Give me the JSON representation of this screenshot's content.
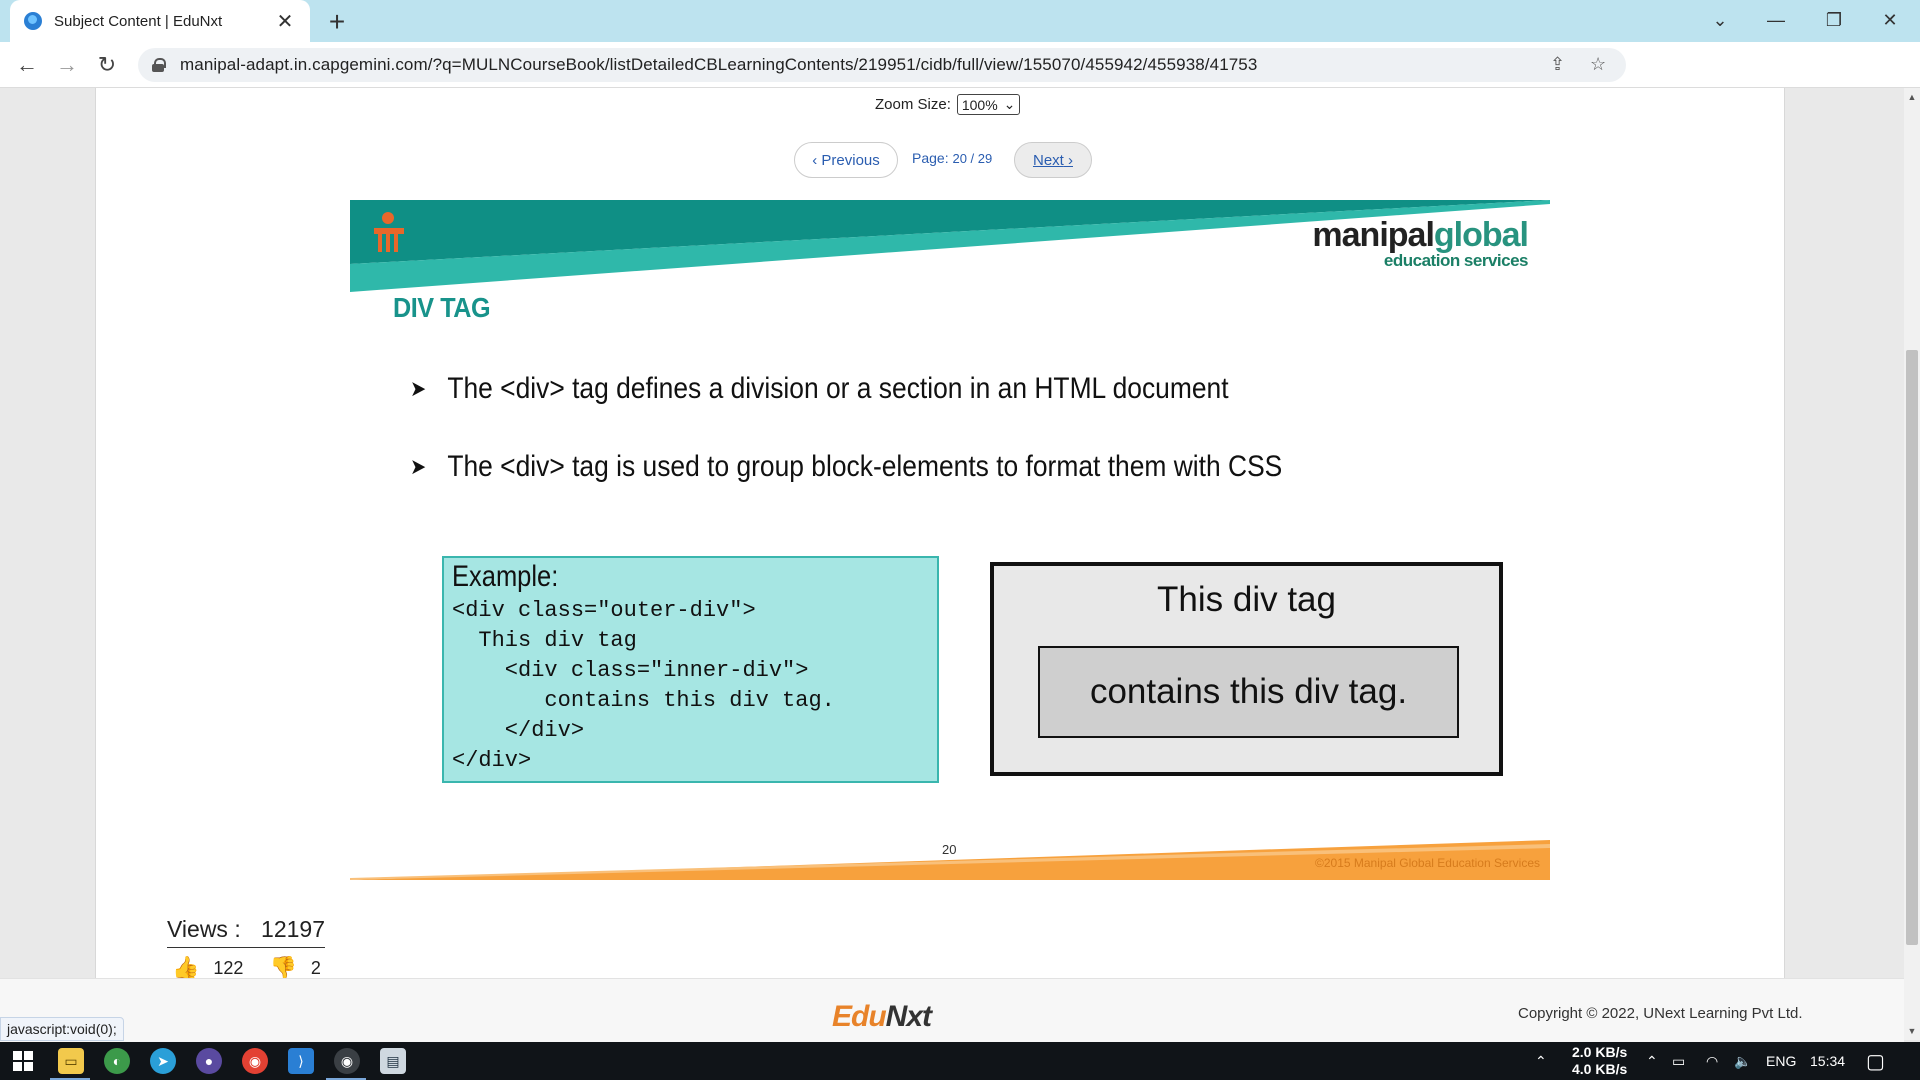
{
  "browser": {
    "tab_title": "Subject Content | EduNxt",
    "url": "manipal-adapt.in.capgemini.com/?q=MULNCourseBook/listDetailedCBLearningContents/219951/cidb/full/view/155070/455942/455938/41753"
  },
  "viewer": {
    "zoom_label": "Zoom Size:",
    "zoom_value": "100%",
    "prev_label": "Previous",
    "page_label": "Page:",
    "page_value": "20 / 29",
    "next_label": "Next"
  },
  "slide": {
    "brand_main_a": "manipal",
    "brand_main_b": "global",
    "brand_sub": "education services",
    "title": "DIV TAG",
    "bullets": [
      "The <div> tag defines a division or a section in an HTML document",
      "The <div> tag is used to group block-elements to format them with CSS"
    ],
    "example_label": "Example:",
    "code": "<div class=\"outer-div\">\n  This div tag\n    <div class=\"inner-div\">\n       contains this div tag.\n    </div>\n</div>",
    "demo_outer_text": "This div tag",
    "demo_inner_text": "contains this div tag.",
    "page_number": "20",
    "slide_copyright": "©2015 Manipal Global Education Services",
    "colors": {
      "teal": "#0f8f85",
      "teal_light": "#2fb8aa",
      "orange": "#f7a13d"
    }
  },
  "stats": {
    "views_label": "Views :",
    "views_value": "12197",
    "likes": "122",
    "dislikes": "2"
  },
  "footer": {
    "logo_a": "Edu",
    "logo_b": "N",
    "logo_c": "xt",
    "copyright": "Copyright © 2022, UNext Learning Pvt Ltd.",
    "status_text": "javascript:void(0);"
  },
  "taskbar": {
    "net_up": "2.0 KB/s",
    "net_down": "4.0 KB/s",
    "lang": "ENG",
    "time": "15:34"
  }
}
